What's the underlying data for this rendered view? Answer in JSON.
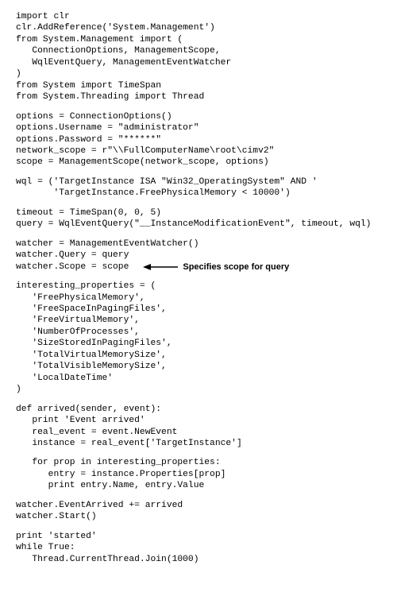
{
  "code": {
    "block1": "import clr\nclr.AddReference('System.Management')\nfrom System.Management import (\n   ConnectionOptions, ManagementScope,\n   WqlEventQuery, ManagementEventWatcher\n)\nfrom System import TimeSpan\nfrom System.Threading import Thread",
    "block2": "options = ConnectionOptions()\noptions.Username = \"administrator\"\noptions.Password = \"******\"\nnetwork_scope = r\"\\\\FullComputerName\\root\\cimv2\"\nscope = ManagementScope(network_scope, options)",
    "block3": "wql = ('TargetInstance ISA \"Win32_OperatingSystem\" AND '\n       'TargetInstance.FreePhysicalMemory < 10000')",
    "block4": "timeout = TimeSpan(0, 0, 5)\nquery = WqlEventQuery(\"__InstanceModificationEvent\", timeout, wql)",
    "block5_line1": "watcher = ManagementEventWatcher()",
    "block5_line2": "watcher.Query = query",
    "block5_line3_code": "watcher.Scope = scope",
    "block6": "interesting_properties = (\n   'FreePhysicalMemory',\n   'FreeSpaceInPagingFiles',\n   'FreeVirtualMemory',\n   'NumberOfProcesses',\n   'SizeStoredInPagingFiles',\n   'TotalVirtualMemorySize',\n   'TotalVisibleMemorySize',\n   'LocalDateTime'\n)",
    "block7_p1": "def arrived(sender, event):\n   print 'Event arrived'\n   real_event = event.NewEvent\n   instance = real_event['TargetInstance']",
    "block7_p2": "   for prop in interesting_properties:\n      entry = instance.Properties[prop]\n      print entry.Name, entry.Value",
    "block8": "watcher.EventArrived += arrived\nwatcher.Start()",
    "block9": "print 'started'\nwhile True:\n   Thread.CurrentThread.Join(1000)"
  },
  "annotation": {
    "text": "Specifies scope for query"
  }
}
